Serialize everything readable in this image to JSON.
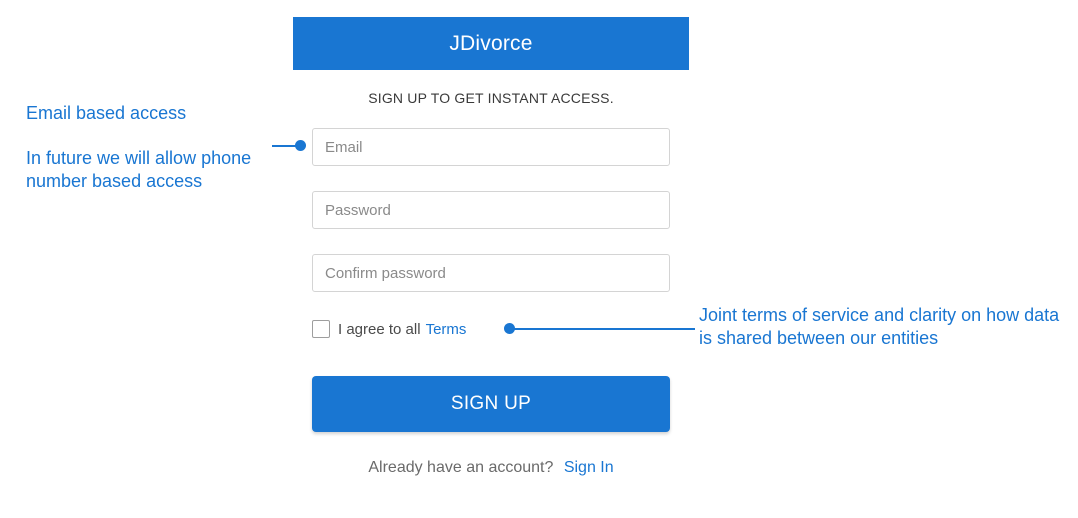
{
  "app": {
    "title": "JDivorce"
  },
  "form": {
    "subtitle": "SIGN UP TO GET INSTANT ACCESS.",
    "email": {
      "placeholder": "Email",
      "value": ""
    },
    "password": {
      "placeholder": "Password",
      "value": ""
    },
    "confirm_password": {
      "placeholder": "Confirm password",
      "value": ""
    },
    "agree": {
      "text": "I agree to all",
      "link_text": "Terms",
      "checked": false
    },
    "submit_label": "SIGN UP",
    "signin_prompt": "Already have an account?",
    "signin_link": "Sign In"
  },
  "annotations": {
    "email_access": "Email based access",
    "phone_access": "In future we will allow phone number based access",
    "terms_note": "Joint terms of service and clarity on how data is shared between our entities"
  },
  "colors": {
    "primary": "#1976d2",
    "text": "#3a3a3a",
    "border": "#d4d4d4"
  },
  "icons": {
    "checkbox": "checkbox-unchecked-icon",
    "connector_dot": "dot-icon"
  }
}
